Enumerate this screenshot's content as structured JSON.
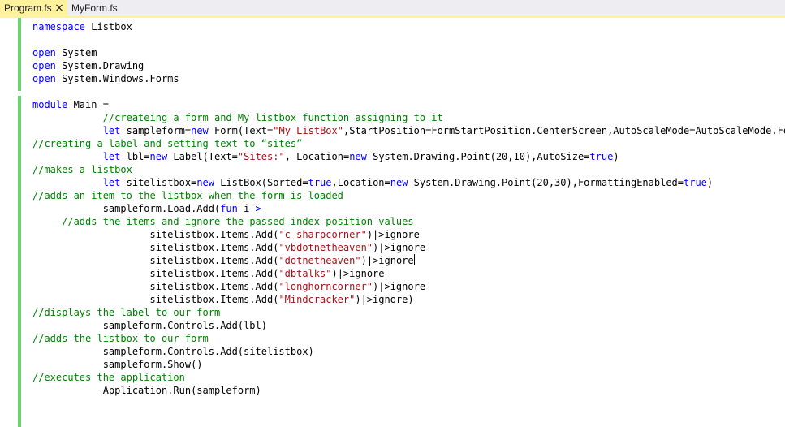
{
  "tabs": [
    {
      "label": "Program.fs",
      "active": true
    },
    {
      "label": "MyForm.fs",
      "active": false
    }
  ],
  "close_icon": "×",
  "colors": {
    "active_tab": "#fff29d",
    "keyword": "#0000ff",
    "string": "#a31515",
    "comment": "#008000",
    "change_bar": "#6cd46c"
  },
  "code_lines": [
    [
      {
        "t": "namespace",
        "c": "kw"
      },
      {
        "t": " Listbox"
      }
    ],
    [],
    [
      {
        "t": "open",
        "c": "kw"
      },
      {
        "t": " System"
      }
    ],
    [
      {
        "t": "open",
        "c": "kw"
      },
      {
        "t": " System.Drawing"
      }
    ],
    [
      {
        "t": "open",
        "c": "kw"
      },
      {
        "t": " System.Windows.Forms"
      }
    ],
    [],
    [
      {
        "t": "module",
        "c": "kw"
      },
      {
        "t": " Main ="
      }
    ],
    [
      {
        "t": "            "
      },
      {
        "t": "//createing a form and My listbox function assigning to it",
        "c": "cm"
      }
    ],
    [
      {
        "t": "            "
      },
      {
        "t": "let",
        "c": "kw"
      },
      {
        "t": " sampleform="
      },
      {
        "t": "new",
        "c": "kw"
      },
      {
        "t": " Form(Text="
      },
      {
        "t": "\"My ListBox\"",
        "c": "str"
      },
      {
        "t": ",StartPosition=FormStartPosition.CenterScreen,AutoScaleMode=AutoScaleMode.Font)"
      }
    ],
    [
      {
        "t": "//creating a label and setting text to “sites”",
        "c": "cm"
      }
    ],
    [
      {
        "t": "            "
      },
      {
        "t": "let",
        "c": "kw"
      },
      {
        "t": " lbl="
      },
      {
        "t": "new",
        "c": "kw"
      },
      {
        "t": " Label(Text="
      },
      {
        "t": "\"Sites:\"",
        "c": "str"
      },
      {
        "t": ", Location="
      },
      {
        "t": "new",
        "c": "kw"
      },
      {
        "t": " System.Drawing.Point(20,10),AutoSize="
      },
      {
        "t": "true",
        "c": "kw"
      },
      {
        "t": ")"
      }
    ],
    [
      {
        "t": "//makes a listbox",
        "c": "cm"
      }
    ],
    [
      {
        "t": "            "
      },
      {
        "t": "let",
        "c": "kw"
      },
      {
        "t": " sitelistbox="
      },
      {
        "t": "new",
        "c": "kw"
      },
      {
        "t": " ListBox(Sorted="
      },
      {
        "t": "true",
        "c": "kw"
      },
      {
        "t": ",Location="
      },
      {
        "t": "new",
        "c": "kw"
      },
      {
        "t": " System.Drawing.Point(20,30),FormattingEnabled="
      },
      {
        "t": "true",
        "c": "kw"
      },
      {
        "t": ")"
      }
    ],
    [
      {
        "t": "//adds an item to the listbox when the form is loaded",
        "c": "cm"
      }
    ],
    [
      {
        "t": "            sampleform.Load.Add("
      },
      {
        "t": "fun",
        "c": "kw"
      },
      {
        "t": " i"
      },
      {
        "t": "->",
        "c": "kw"
      }
    ],
    [
      {
        "t": "     "
      },
      {
        "t": "//adds the items and ignore the passed index position values",
        "c": "cm"
      }
    ],
    [
      {
        "t": "                    sitelistbox.Items.Add("
      },
      {
        "t": "\"c-sharpcorner\"",
        "c": "str"
      },
      {
        "t": ")|>ignore"
      }
    ],
    [
      {
        "t": "                    sitelistbox.Items.Add("
      },
      {
        "t": "\"vbdotnetheaven\"",
        "c": "str"
      },
      {
        "t": ")|>ignore"
      }
    ],
    [
      {
        "t": "                    sitelistbox.Items.Add("
      },
      {
        "t": "\"dotnetheaven\"",
        "c": "str"
      },
      {
        "t": ")|>ignore"
      },
      {
        "caret": true
      }
    ],
    [
      {
        "t": "                    sitelistbox.Items.Add("
      },
      {
        "t": "\"dbtalks\"",
        "c": "str"
      },
      {
        "t": ")|>ignore"
      }
    ],
    [
      {
        "t": "                    sitelistbox.Items.Add("
      },
      {
        "t": "\"longhorncorner\"",
        "c": "str"
      },
      {
        "t": ")|>ignore"
      }
    ],
    [
      {
        "t": "                    sitelistbox.Items.Add("
      },
      {
        "t": "\"Mindcracker\"",
        "c": "str"
      },
      {
        "t": ")|>ignore)"
      }
    ],
    [
      {
        "t": "//displays the label to our form",
        "c": "cm"
      }
    ],
    [
      {
        "t": "            sampleform.Controls.Add(lbl)"
      }
    ],
    [
      {
        "t": "//adds the listbox to our form",
        "c": "cm"
      }
    ],
    [
      {
        "t": "            sampleform.Controls.Add(sitelistbox)"
      }
    ],
    [
      {
        "t": "            sampleform.Show()"
      }
    ],
    [
      {
        "t": "//executes the application",
        "c": "cm"
      }
    ],
    [
      {
        "t": "            Application.Run(sampleform)"
      }
    ]
  ]
}
